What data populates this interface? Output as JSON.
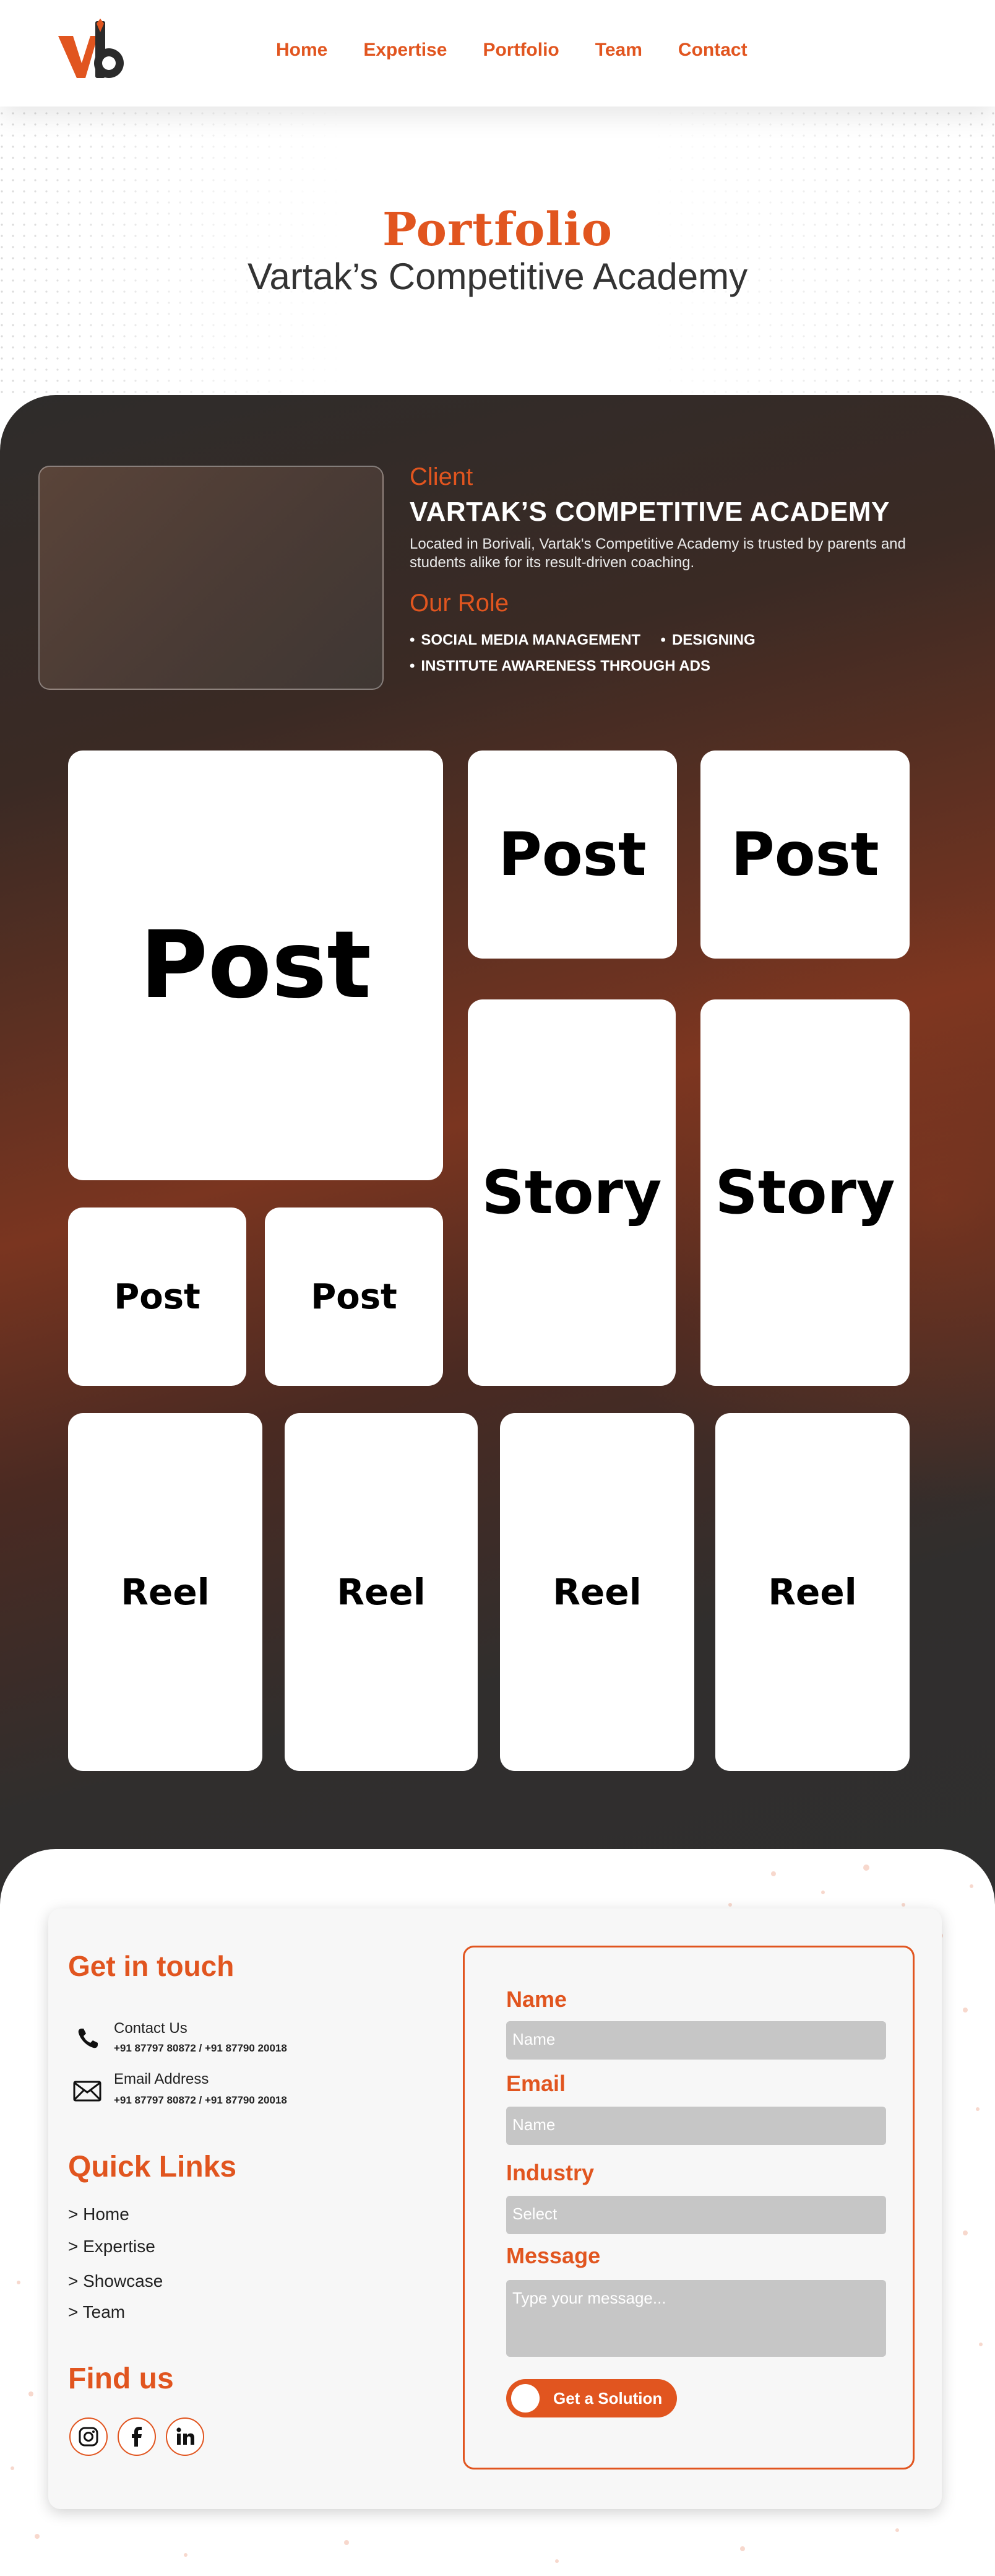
{
  "header": {
    "nav": [
      "Home",
      "Expertise",
      "Portfolio",
      "Team",
      "Contact"
    ]
  },
  "hero": {
    "title": "Portfolio",
    "subtitle": "Vartak’s Competitive Academy"
  },
  "portfolio": {
    "client_label": "Client",
    "client_name": "VARTAK’S COMPETITIVE ACADEMY",
    "client_desc": "Located in Borivali, Vartak's Competitive Academy is trusted by parents and students alike for its result-driven coaching.",
    "role_label": "Our Role",
    "roles": [
      "SOCIAL MEDIA MANAGEMENT",
      "DESIGNING",
      "INSTITUTE AWARENESS THROUGH ADS"
    ],
    "cards": {
      "post_big": "Post",
      "post_top1": "Post",
      "post_top2": "Post",
      "story1": "Story",
      "story2": "Story",
      "post_small1": "Post",
      "post_small2": "Post",
      "reel1": "Reel",
      "reel2": "Reel",
      "reel3": "Reel",
      "reel4": "Reel"
    }
  },
  "contact": {
    "get_in_touch": "Get in touch",
    "contact_us_label": "Contact Us",
    "phone": "+91 87797 80872 / +91 87790 20018",
    "email_label": "Email Address",
    "email_value": "+91 87797 80872 / +91 87790 20018",
    "quick_links_title": "Quick Links",
    "quick_links": [
      "> Home",
      "> Expertise",
      "> Showcase",
      "> Team"
    ],
    "find_us_title": "Find us",
    "social": [
      "instagram",
      "facebook",
      "linkedin"
    ]
  },
  "form": {
    "name_label": "Name",
    "name_placeholder": "Name",
    "email_label": "Email",
    "email_placeholder": "Name",
    "industry_label": "Industry",
    "industry_value": "Select",
    "message_label": "Message",
    "message_placeholder": "Type your message...",
    "submit": "Get a Solution"
  },
  "colors": {
    "accent": "#e1551f",
    "panel_dark": "#2f2f2f",
    "input_grey": "#c6c6c6"
  }
}
